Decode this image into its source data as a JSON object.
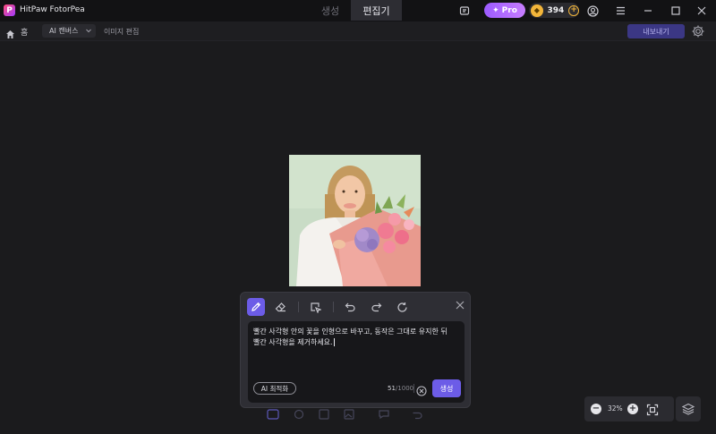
{
  "window": {
    "app_name": "HitPaw FotorPea",
    "logo_letter": "P",
    "mode_tabs": [
      {
        "label": "생성",
        "active": false
      },
      {
        "label": "편집기",
        "active": true
      }
    ],
    "pro_label": "Pro",
    "credits": "394"
  },
  "subbar": {
    "home_label": "홈",
    "ai_canvas": "AI 캔버스",
    "image_edit": "이미지 편집",
    "export_label": "내보내기"
  },
  "prompt_panel": {
    "text": "빨간 사각형 안의 꽃을 인형으로 바꾸고, 동작은 그대로 유지한 뒤\n빨간 사각형을 제거하세요.",
    "ai_optimize_label": "AI 최적화",
    "char_count": "51",
    "char_max": "/1000",
    "generate_label": "생성"
  },
  "zoom": {
    "value": "32%"
  },
  "colors": {
    "accent": "#6c5ce7",
    "pro_gradient_start": "#9c5bff",
    "coin": "#f2b53a",
    "background": "#1b1b1d"
  }
}
